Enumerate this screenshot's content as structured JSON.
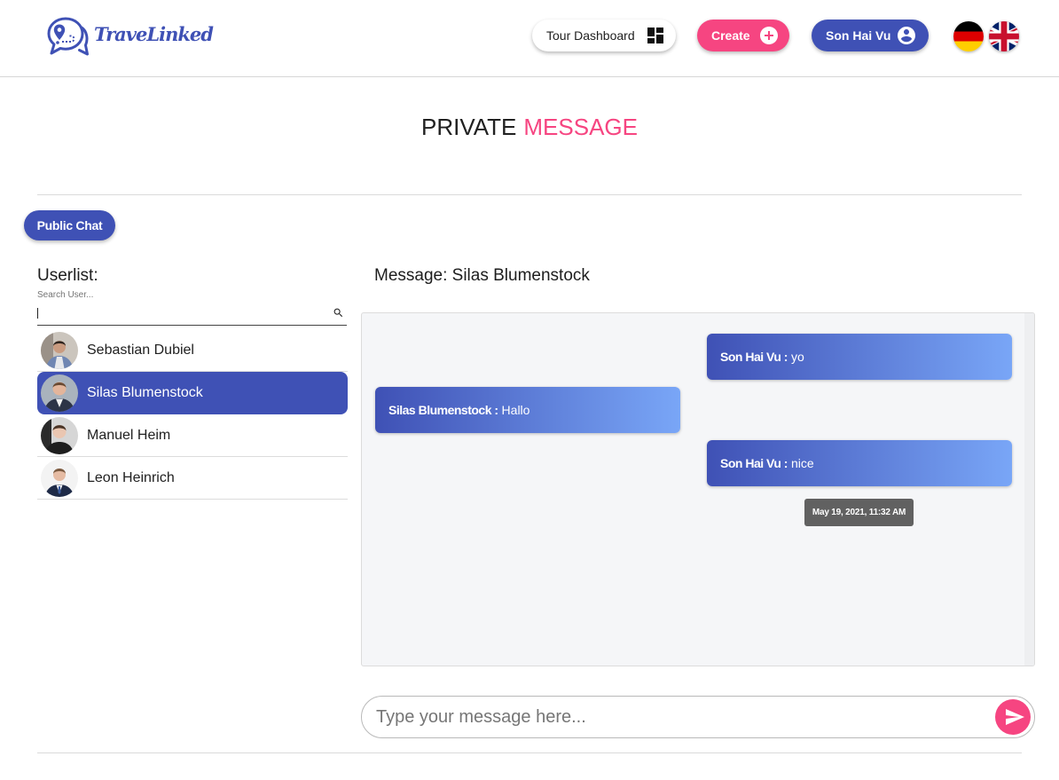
{
  "header": {
    "logo": {
      "text": "TraveLinked",
      "icon": "travel-chat-pin-icon"
    },
    "tour_dashboard": {
      "label": "Tour Dashboard",
      "icon": "dashboard-icon"
    },
    "create": {
      "label": "Create",
      "icon": "add-circle-icon"
    },
    "user": {
      "label": "Son Hai Vu",
      "icon": "account-circle-icon"
    },
    "language_flags": [
      {
        "icon": "german-flag-icon"
      },
      {
        "icon": "uk-flag-icon"
      }
    ]
  },
  "page_title": {
    "part1": "PRIVATE",
    "part2": "MESSAGE"
  },
  "public_chat_button": {
    "label": "Public Chat"
  },
  "userlist": {
    "heading": "Userlist:",
    "search": {
      "label": "Search User...",
      "value": "",
      "icon": "search-icon"
    },
    "users": [
      {
        "name": "Sebastian Dubiel",
        "selected": false
      },
      {
        "name": "Silas Blumenstock",
        "selected": true
      },
      {
        "name": "Manuel Heim",
        "selected": false
      },
      {
        "name": "Leon Heinrich",
        "selected": false
      }
    ]
  },
  "conversation": {
    "heading": "Message: Silas Blumenstock",
    "messages": [
      {
        "sender": "Son Hai Vu :",
        "text": "yo",
        "outgoing": true
      },
      {
        "sender": "Silas Blumenstock :",
        "text": "Hallo",
        "outgoing": false
      },
      {
        "sender": "Son Hai Vu :",
        "text": "nice",
        "outgoing": true
      }
    ],
    "timestamp_tooltip": "May 19, 2021, 11:32 AM"
  },
  "composer": {
    "placeholder": "Type your message here...",
    "value": "",
    "send_icon": "send-icon"
  },
  "colors": {
    "primary": "#3f51b5",
    "accent": "#f64581",
    "bubble_gradient_end": "#79a6f7",
    "tooltip": "#616161"
  }
}
